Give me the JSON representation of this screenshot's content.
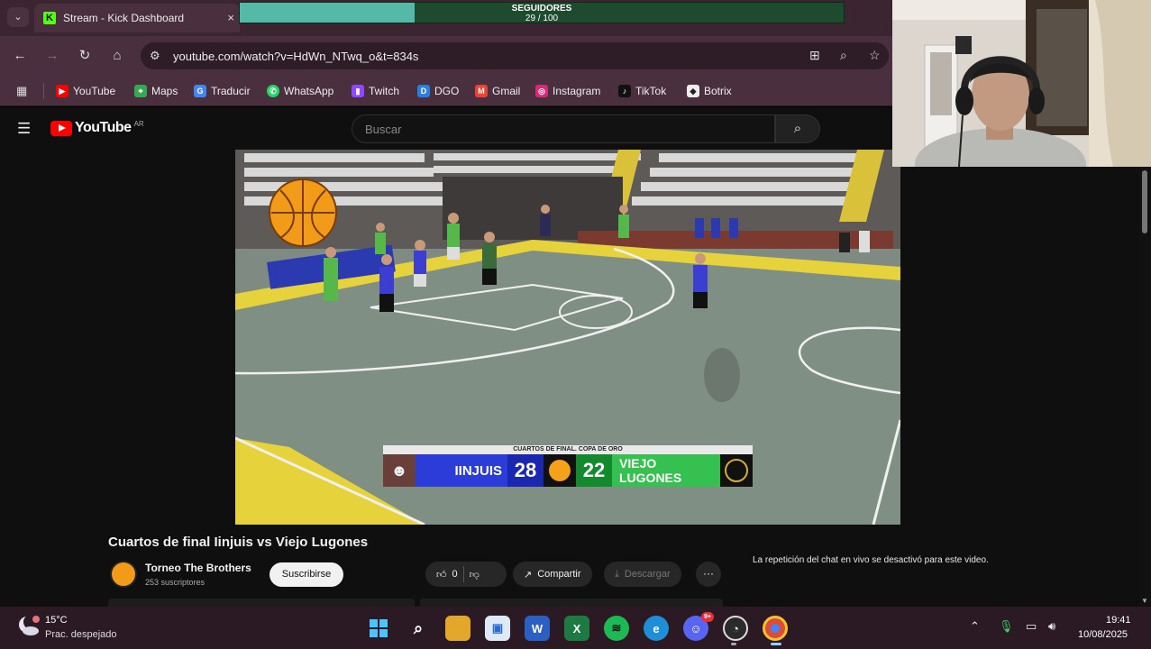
{
  "browser": {
    "tab": {
      "title": "Stream - Kick Dashboard",
      "favicon": "K"
    },
    "tab_close": "×",
    "url": "youtube.com/watch?v=HdWn_NTwq_o&t=834s",
    "bookmarks": [
      {
        "label": "YouTube",
        "icon": "youtube-icon",
        "color": "#ff0000"
      },
      {
        "label": "Maps",
        "icon": "maps-icon",
        "color": "#34a853"
      },
      {
        "label": "Traducir",
        "icon": "translate-icon",
        "color": "#4285f4"
      },
      {
        "label": "WhatsApp",
        "icon": "whatsapp-icon",
        "color": "#25d366"
      },
      {
        "label": "Twitch",
        "icon": "twitch-icon",
        "color": "#9146ff"
      },
      {
        "label": "DGO",
        "icon": "dgo-icon",
        "color": "#2a7de1"
      },
      {
        "label": "Gmail",
        "icon": "gmail-icon",
        "color": "#ea4335"
      },
      {
        "label": "Instagram",
        "icon": "instagram-icon",
        "color": "#d62976"
      },
      {
        "label": "TikTok",
        "icon": "tiktok-icon",
        "color": "#111111"
      },
      {
        "label": "Botrix",
        "icon": "botrix-icon",
        "color": "#eeeeee"
      }
    ]
  },
  "overlay": {
    "title": "SEGUIDORES",
    "count_text": "29 / 100",
    "progress": 0.29,
    "fill_color": "#55b9a8"
  },
  "youtube": {
    "logo_text": "YouTube",
    "region": "AR",
    "search_placeholder": "Buscar"
  },
  "scoreboard": {
    "header": "CUARTOS DE FINAL. COPA DE ORO",
    "team1": "IINJUIS",
    "score1": "28",
    "team2": "VIEJO LUGONES",
    "score2": "22",
    "team1_color": "#2c3cd6",
    "team2_color": "#36c04f"
  },
  "video_info": {
    "title": "Cuartos de final Iinjuis vs Viejo Lugones",
    "channel": "Torneo The Brothers",
    "subscribers": "253 suscriptores",
    "subscribe_label": "Suscribirse",
    "likes": "0",
    "share_label": "Compartir",
    "download_label": "Descargar",
    "more_label": "···",
    "chat_note": "La repetición del chat en vivo se desactivó para este video."
  },
  "taskbar": {
    "weather_temp": "15°C",
    "weather_desc": "Prac. despejado",
    "discord_badge": "9+",
    "time": "19:41",
    "date": "10/08/2025"
  }
}
